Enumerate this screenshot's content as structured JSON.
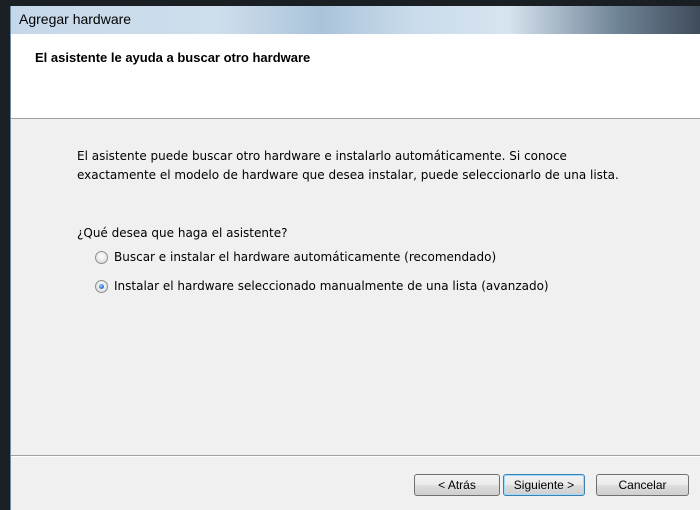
{
  "window": {
    "title": "Agregar hardware"
  },
  "header": {
    "title": "El asistente le ayuda a buscar otro hardware"
  },
  "body": {
    "description_line1": "El asistente puede buscar otro hardware e instalarlo automáticamente. Si conoce",
    "description_line2": "exactamente el modelo de hardware que desea instalar, puede seleccionarlo de una lista.",
    "question": "¿Qué desea que haga el asistente?",
    "options": [
      {
        "label": "Buscar e instalar el hardware automáticamente (recomendado)",
        "selected": false
      },
      {
        "label": "Instalar el hardware seleccionado manualmente de una lista (avanzado)",
        "selected": true
      }
    ]
  },
  "buttons": {
    "back": "< Atrás",
    "next": "Siguiente >",
    "cancel": "Cancelar"
  },
  "colors": {
    "dialog_bg": "#f0f0f0",
    "header_bg": "#ffffff",
    "default_button_border": "#3c7fb1"
  }
}
